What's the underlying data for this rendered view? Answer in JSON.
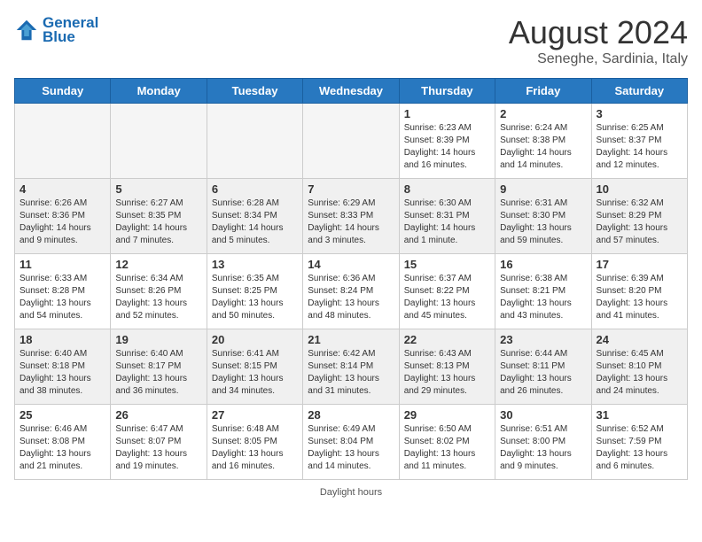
{
  "header": {
    "logo_line1": "General",
    "logo_line2": "Blue",
    "month_year": "August 2024",
    "location": "Seneghe, Sardinia, Italy"
  },
  "days_of_week": [
    "Sunday",
    "Monday",
    "Tuesday",
    "Wednesday",
    "Thursday",
    "Friday",
    "Saturday"
  ],
  "footer_label": "Daylight hours",
  "weeks": [
    [
      {
        "day": "",
        "empty": true
      },
      {
        "day": "",
        "empty": true
      },
      {
        "day": "",
        "empty": true
      },
      {
        "day": "",
        "empty": true
      },
      {
        "day": "1",
        "sunrise": "Sunrise: 6:23 AM",
        "sunset": "Sunset: 8:39 PM",
        "daylight": "Daylight: 14 hours and 16 minutes."
      },
      {
        "day": "2",
        "sunrise": "Sunrise: 6:24 AM",
        "sunset": "Sunset: 8:38 PM",
        "daylight": "Daylight: 14 hours and 14 minutes."
      },
      {
        "day": "3",
        "sunrise": "Sunrise: 6:25 AM",
        "sunset": "Sunset: 8:37 PM",
        "daylight": "Daylight: 14 hours and 12 minutes."
      }
    ],
    [
      {
        "day": "4",
        "sunrise": "Sunrise: 6:26 AM",
        "sunset": "Sunset: 8:36 PM",
        "daylight": "Daylight: 14 hours and 9 minutes."
      },
      {
        "day": "5",
        "sunrise": "Sunrise: 6:27 AM",
        "sunset": "Sunset: 8:35 PM",
        "daylight": "Daylight: 14 hours and 7 minutes."
      },
      {
        "day": "6",
        "sunrise": "Sunrise: 6:28 AM",
        "sunset": "Sunset: 8:34 PM",
        "daylight": "Daylight: 14 hours and 5 minutes."
      },
      {
        "day": "7",
        "sunrise": "Sunrise: 6:29 AM",
        "sunset": "Sunset: 8:33 PM",
        "daylight": "Daylight: 14 hours and 3 minutes."
      },
      {
        "day": "8",
        "sunrise": "Sunrise: 6:30 AM",
        "sunset": "Sunset: 8:31 PM",
        "daylight": "Daylight: 14 hours and 1 minute."
      },
      {
        "day": "9",
        "sunrise": "Sunrise: 6:31 AM",
        "sunset": "Sunset: 8:30 PM",
        "daylight": "Daylight: 13 hours and 59 minutes."
      },
      {
        "day": "10",
        "sunrise": "Sunrise: 6:32 AM",
        "sunset": "Sunset: 8:29 PM",
        "daylight": "Daylight: 13 hours and 57 minutes."
      }
    ],
    [
      {
        "day": "11",
        "sunrise": "Sunrise: 6:33 AM",
        "sunset": "Sunset: 8:28 PM",
        "daylight": "Daylight: 13 hours and 54 minutes."
      },
      {
        "day": "12",
        "sunrise": "Sunrise: 6:34 AM",
        "sunset": "Sunset: 8:26 PM",
        "daylight": "Daylight: 13 hours and 52 minutes."
      },
      {
        "day": "13",
        "sunrise": "Sunrise: 6:35 AM",
        "sunset": "Sunset: 8:25 PM",
        "daylight": "Daylight: 13 hours and 50 minutes."
      },
      {
        "day": "14",
        "sunrise": "Sunrise: 6:36 AM",
        "sunset": "Sunset: 8:24 PM",
        "daylight": "Daylight: 13 hours and 48 minutes."
      },
      {
        "day": "15",
        "sunrise": "Sunrise: 6:37 AM",
        "sunset": "Sunset: 8:22 PM",
        "daylight": "Daylight: 13 hours and 45 minutes."
      },
      {
        "day": "16",
        "sunrise": "Sunrise: 6:38 AM",
        "sunset": "Sunset: 8:21 PM",
        "daylight": "Daylight: 13 hours and 43 minutes."
      },
      {
        "day": "17",
        "sunrise": "Sunrise: 6:39 AM",
        "sunset": "Sunset: 8:20 PM",
        "daylight": "Daylight: 13 hours and 41 minutes."
      }
    ],
    [
      {
        "day": "18",
        "sunrise": "Sunrise: 6:40 AM",
        "sunset": "Sunset: 8:18 PM",
        "daylight": "Daylight: 13 hours and 38 minutes."
      },
      {
        "day": "19",
        "sunrise": "Sunrise: 6:40 AM",
        "sunset": "Sunset: 8:17 PM",
        "daylight": "Daylight: 13 hours and 36 minutes."
      },
      {
        "day": "20",
        "sunrise": "Sunrise: 6:41 AM",
        "sunset": "Sunset: 8:15 PM",
        "daylight": "Daylight: 13 hours and 34 minutes."
      },
      {
        "day": "21",
        "sunrise": "Sunrise: 6:42 AM",
        "sunset": "Sunset: 8:14 PM",
        "daylight": "Daylight: 13 hours and 31 minutes."
      },
      {
        "day": "22",
        "sunrise": "Sunrise: 6:43 AM",
        "sunset": "Sunset: 8:13 PM",
        "daylight": "Daylight: 13 hours and 29 minutes."
      },
      {
        "day": "23",
        "sunrise": "Sunrise: 6:44 AM",
        "sunset": "Sunset: 8:11 PM",
        "daylight": "Daylight: 13 hours and 26 minutes."
      },
      {
        "day": "24",
        "sunrise": "Sunrise: 6:45 AM",
        "sunset": "Sunset: 8:10 PM",
        "daylight": "Daylight: 13 hours and 24 minutes."
      }
    ],
    [
      {
        "day": "25",
        "sunrise": "Sunrise: 6:46 AM",
        "sunset": "Sunset: 8:08 PM",
        "daylight": "Daylight: 13 hours and 21 minutes."
      },
      {
        "day": "26",
        "sunrise": "Sunrise: 6:47 AM",
        "sunset": "Sunset: 8:07 PM",
        "daylight": "Daylight: 13 hours and 19 minutes."
      },
      {
        "day": "27",
        "sunrise": "Sunrise: 6:48 AM",
        "sunset": "Sunset: 8:05 PM",
        "daylight": "Daylight: 13 hours and 16 minutes."
      },
      {
        "day": "28",
        "sunrise": "Sunrise: 6:49 AM",
        "sunset": "Sunset: 8:04 PM",
        "daylight": "Daylight: 13 hours and 14 minutes."
      },
      {
        "day": "29",
        "sunrise": "Sunrise: 6:50 AM",
        "sunset": "Sunset: 8:02 PM",
        "daylight": "Daylight: 13 hours and 11 minutes."
      },
      {
        "day": "30",
        "sunrise": "Sunrise: 6:51 AM",
        "sunset": "Sunset: 8:00 PM",
        "daylight": "Daylight: 13 hours and 9 minutes."
      },
      {
        "day": "31",
        "sunrise": "Sunrise: 6:52 AM",
        "sunset": "Sunset: 7:59 PM",
        "daylight": "Daylight: 13 hours and 6 minutes."
      }
    ]
  ]
}
